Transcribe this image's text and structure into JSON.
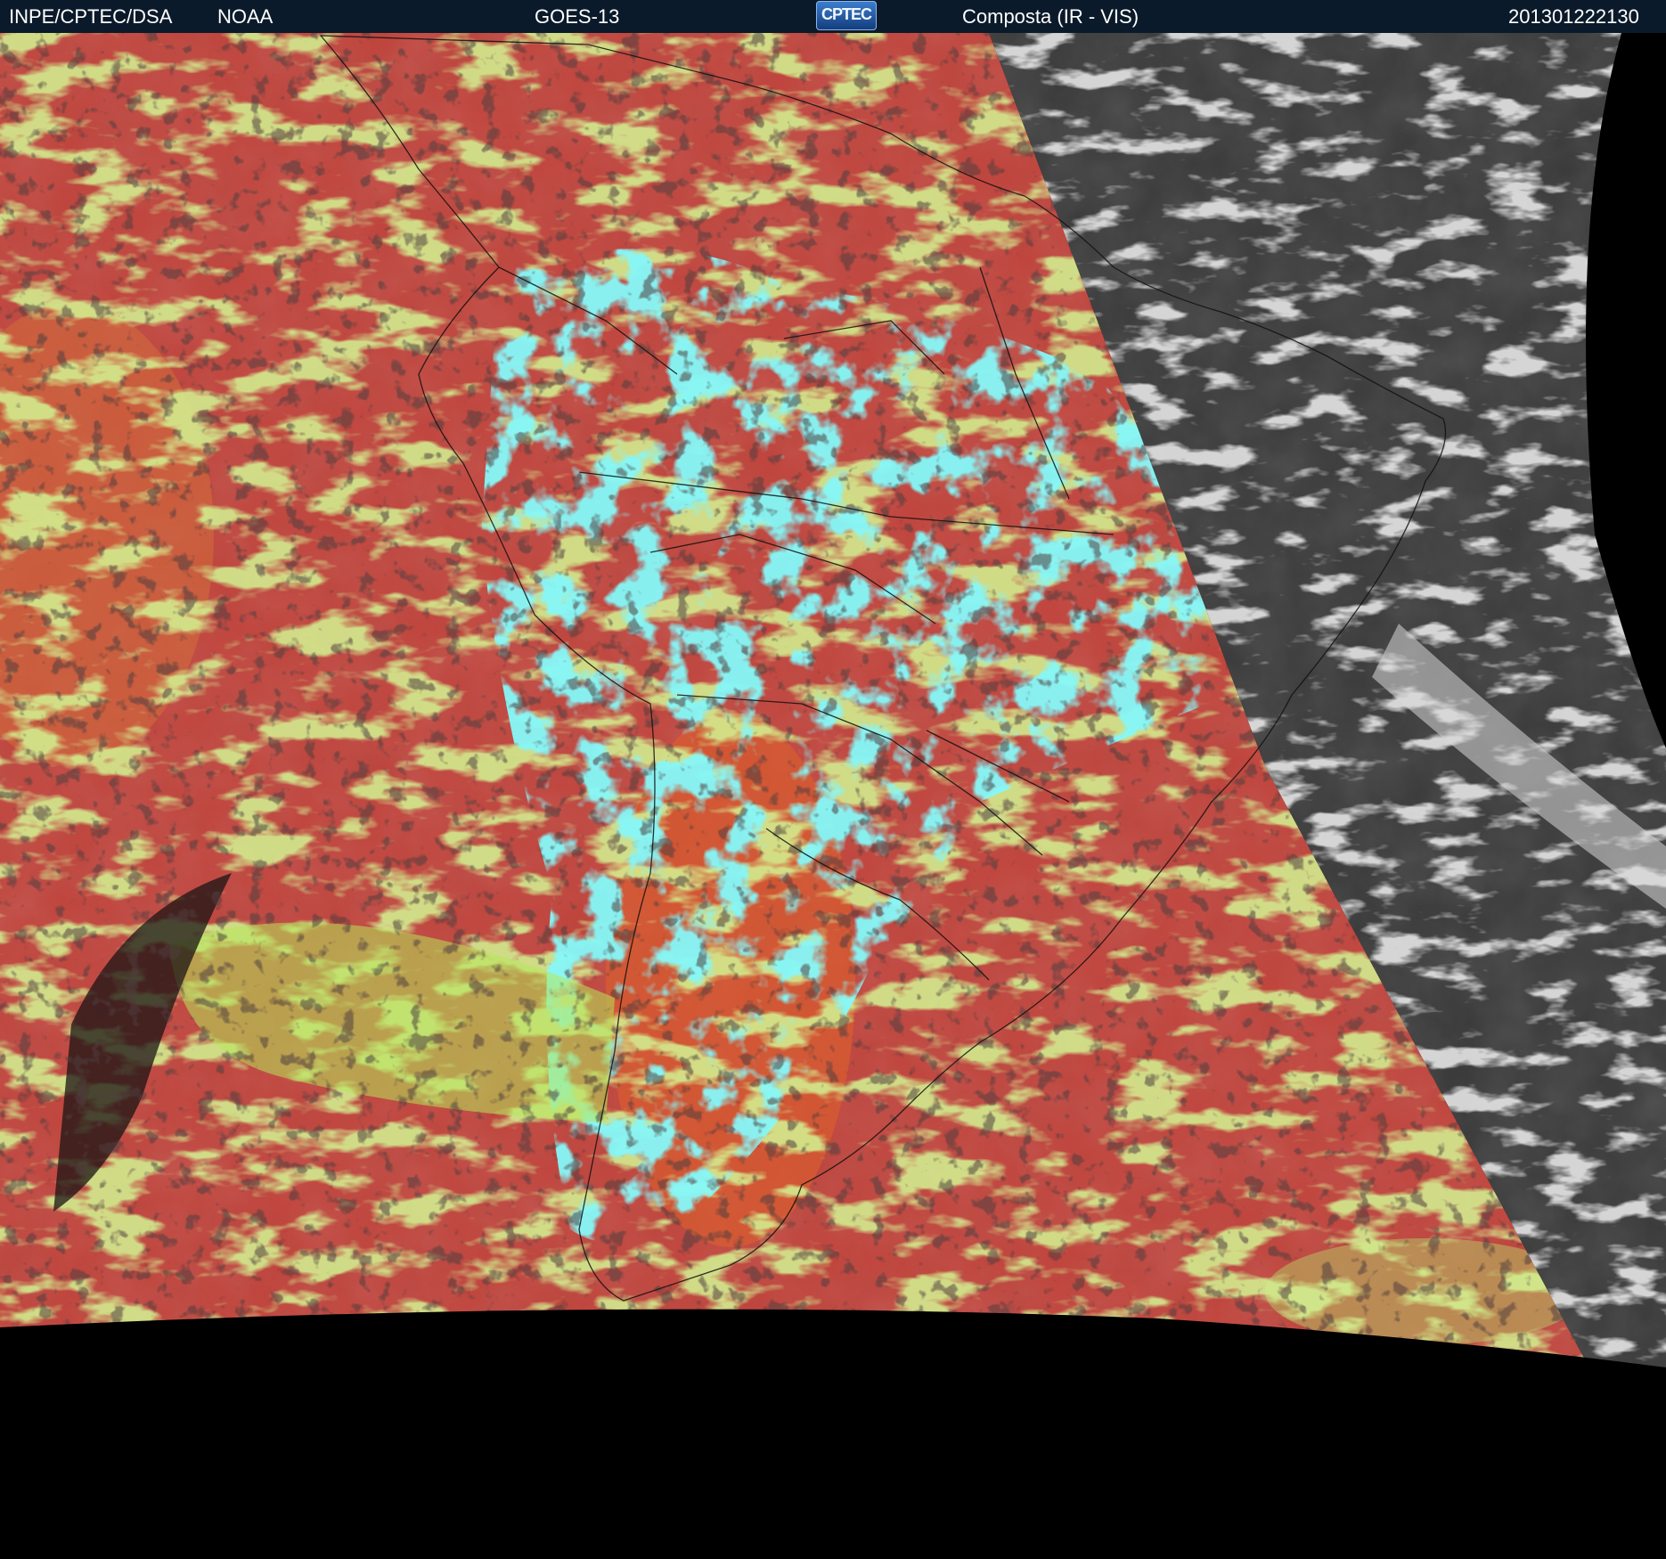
{
  "header": {
    "org": "INPE/CPTEC/DSA",
    "agency": "NOAA",
    "satellite": "GOES-13",
    "logo_text": "CPTEC",
    "product": "Composta (IR - VIS)",
    "timestamp": "201301222130"
  },
  "colors": {
    "bar": "#0b1a2a",
    "ir_warm": "#c0443c",
    "ir_low_cloud": "#a8e84a",
    "ir_high_cloud": "#3cf0f0",
    "vis_background": "#3a3a3a",
    "vis_cloud": "#d8d8d8",
    "space": "#000000"
  },
  "icons": [
    "cptec-logo"
  ]
}
